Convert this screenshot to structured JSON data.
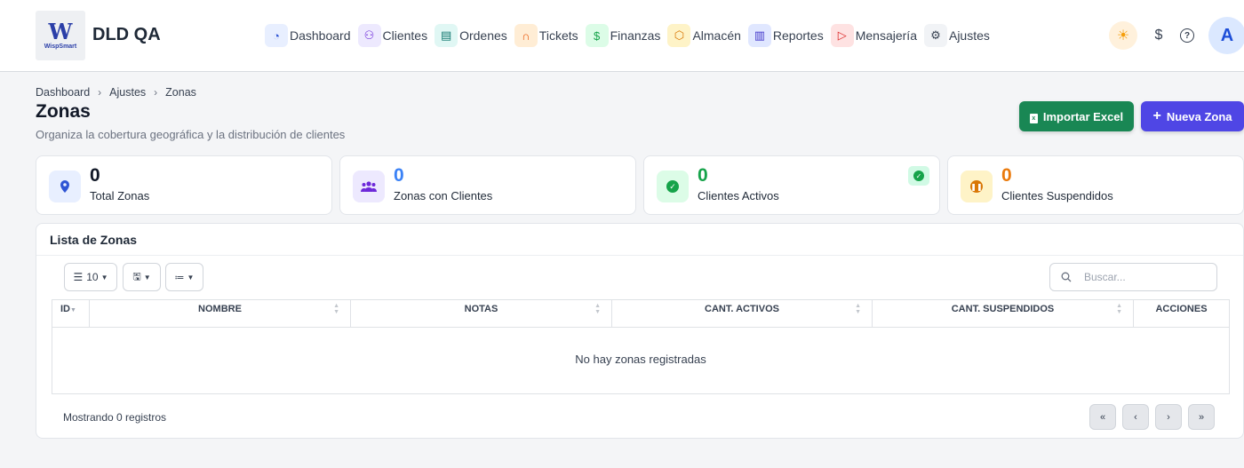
{
  "header": {
    "logo_text": "WispSmart",
    "logo_letter": "W",
    "brand": "DLD QA",
    "nav": [
      {
        "label": "Dashboard",
        "icon": "chart-pie-icon",
        "glyph": "◔",
        "bg": "#e8efff",
        "fg": "#2f55d4"
      },
      {
        "label": "Clientes",
        "icon": "users-icon",
        "glyph": "⚇",
        "bg": "#ede9fe",
        "fg": "#6d28d9"
      },
      {
        "label": "Ordenes",
        "icon": "document-icon",
        "glyph": "▤",
        "bg": "#e0f7f4",
        "fg": "#0f766e"
      },
      {
        "label": "Tickets",
        "icon": "headset-icon",
        "glyph": "∩",
        "bg": "#ffedd5",
        "fg": "#ea580c"
      },
      {
        "label": "Finanzas",
        "icon": "dollar-icon",
        "glyph": "$",
        "bg": "#dcfce7",
        "fg": "#16a34a"
      },
      {
        "label": "Almacén",
        "icon": "box-icon",
        "glyph": "⬡",
        "bg": "#fef3c7",
        "fg": "#d97706"
      },
      {
        "label": "Reportes",
        "icon": "bar-chart-icon",
        "glyph": "▥",
        "bg": "#e0e7ff",
        "fg": "#4338ca"
      },
      {
        "label": "Mensajería",
        "icon": "send-icon",
        "glyph": "▷",
        "bg": "#fee2e2",
        "fg": "#dc2626"
      },
      {
        "label": "Ajustes",
        "icon": "gear-icon",
        "glyph": "⚙",
        "bg": "#f1f3f6",
        "fg": "#374151"
      }
    ],
    "avatar_letter": "A",
    "theme_icon": "sun-icon",
    "currency_icon": "dollar-icon",
    "help_icon": "question-icon"
  },
  "breadcrumb": [
    "Dashboard",
    "Ajustes",
    "Zonas"
  ],
  "page": {
    "title": "Zonas",
    "subtitle": "Organiza la cobertura geográfica y la distribución de clientes",
    "import_label": "Importar Excel",
    "new_label": "Nueva Zona"
  },
  "stats": [
    {
      "value": "0",
      "label": "Total Zonas",
      "icon": "map-pin-icon",
      "color": "#2f55d4",
      "bg": "#e8efff"
    },
    {
      "value": "0",
      "label": "Zonas con Clientes",
      "icon": "users-icon",
      "color": "#3b82f6",
      "bg": "#ede9fe"
    },
    {
      "value": "0",
      "label": "Clientes Activos",
      "icon": "check-circle-icon",
      "color": "#16a34a",
      "bg": "#dcfce7"
    },
    {
      "value": "0",
      "label": "Clientes Suspendidos",
      "icon": "pause-circle-icon",
      "color": "#ea7a0c",
      "bg": "#fef3c7"
    }
  ],
  "list": {
    "title": "Lista de Zonas",
    "page_size": "10",
    "search_placeholder": "Buscar...",
    "columns": [
      "ID",
      "NOMBRE",
      "NOTAS",
      "CANT. ACTIVOS",
      "CANT. SUSPENDIDOS",
      "ACCIONES"
    ],
    "empty_message": "No hay zonas registradas",
    "footer": "Mostrando 0 registros",
    "pagination": [
      "«",
      "‹",
      "›",
      "»"
    ]
  }
}
